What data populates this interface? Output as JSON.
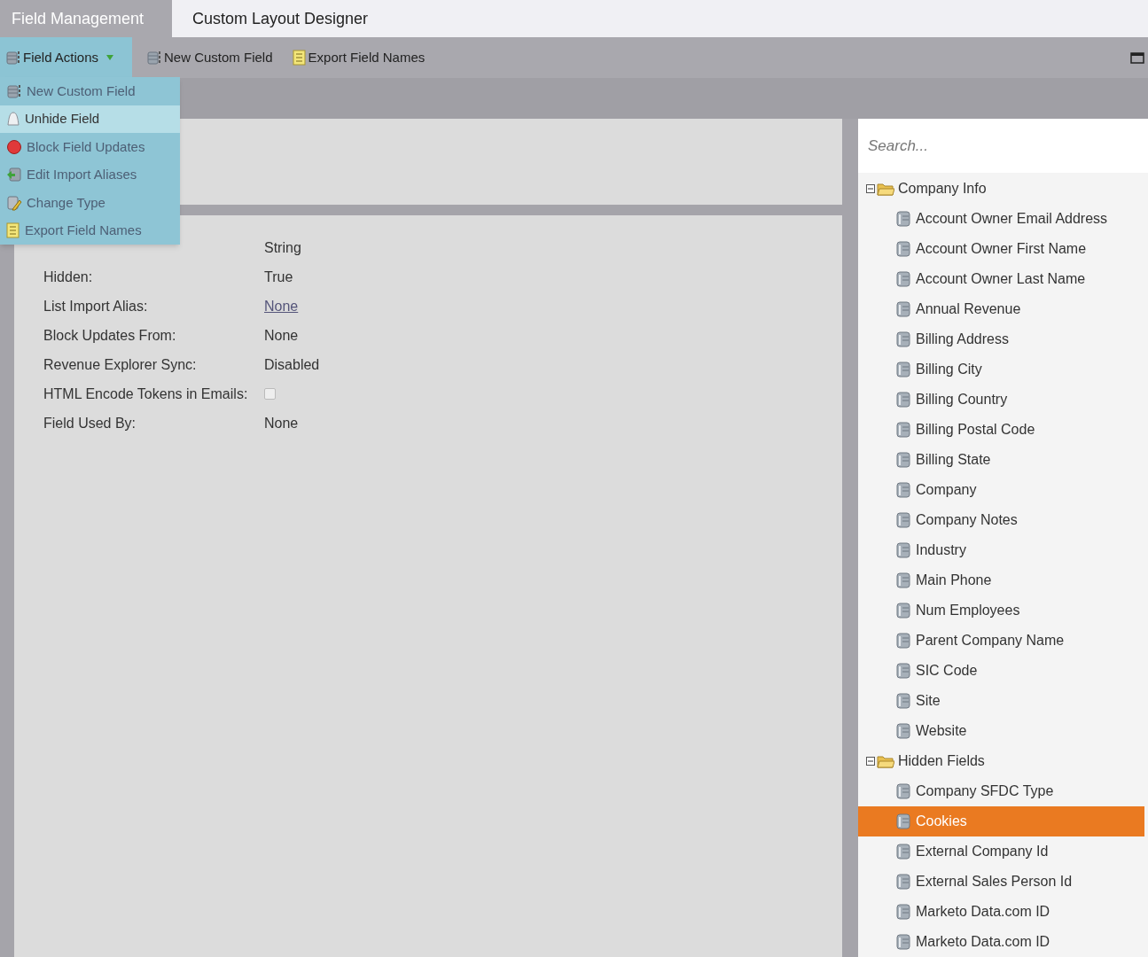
{
  "tabs": [
    {
      "label": "Field Management",
      "selected": true
    },
    {
      "label": "Custom Layout Designer",
      "selected": false
    }
  ],
  "toolbar": [
    {
      "label": "Field Actions",
      "kind": "db",
      "expanded": true
    },
    {
      "label": "New Custom Field",
      "kind": "db"
    },
    {
      "label": "Export Field Names",
      "kind": "sheet"
    }
  ],
  "menu": [
    {
      "label": "New Custom Field",
      "kind": "db",
      "highlighted": false
    },
    {
      "label": "Unhide Field",
      "kind": "ghost",
      "highlighted": true
    },
    {
      "label": "Block Field Updates",
      "kind": "stop",
      "highlighted": false
    },
    {
      "label": "Edit Import Aliases",
      "kind": "alias",
      "highlighted": false
    },
    {
      "label": "Change Type",
      "kind": "edit",
      "highlighted": false
    },
    {
      "label": "Export Field Names",
      "kind": "sheet",
      "highlighted": false
    }
  ],
  "details": [
    {
      "kind": "text",
      "value": "String"
    },
    {
      "kind": "text",
      "label": "Hidden:",
      "value": "True"
    },
    {
      "kind": "link",
      "label": "List Import Alias:",
      "value": "None"
    },
    {
      "kind": "text",
      "label": "Block Updates From:",
      "value": "None"
    },
    {
      "kind": "text",
      "label": "Revenue Explorer Sync:",
      "value": "Disabled"
    },
    {
      "kind": "checkbox",
      "label": "HTML Encode Tokens in Emails:",
      "checked": false
    },
    {
      "kind": "text",
      "label": "Field Used By:",
      "value": "None"
    }
  ],
  "search": {
    "placeholder": "Search..."
  },
  "tree": [
    {
      "label": "Company Info",
      "expanded": true,
      "children": [
        {
          "label": "Account Owner Email Address",
          "selected": false
        },
        {
          "label": "Account Owner First Name",
          "selected": false
        },
        {
          "label": "Account Owner Last Name",
          "selected": false
        },
        {
          "label": "Annual Revenue",
          "selected": false
        },
        {
          "label": "Billing Address",
          "selected": false
        },
        {
          "label": "Billing City",
          "selected": false
        },
        {
          "label": "Billing Country",
          "selected": false
        },
        {
          "label": "Billing Postal Code",
          "selected": false
        },
        {
          "label": "Billing State",
          "selected": false
        },
        {
          "label": "Company",
          "selected": false
        },
        {
          "label": "Company Notes",
          "selected": false
        },
        {
          "label": "Industry",
          "selected": false
        },
        {
          "label": "Main Phone",
          "selected": false
        },
        {
          "label": "Num Employees",
          "selected": false
        },
        {
          "label": "Parent Company Name",
          "selected": false
        },
        {
          "label": "SIC Code",
          "selected": false
        },
        {
          "label": "Site",
          "selected": false
        },
        {
          "label": "Website",
          "selected": false
        }
      ]
    },
    {
      "label": "Hidden Fields",
      "expanded": true,
      "children": [
        {
          "label": "Company SFDC Type",
          "selected": false
        },
        {
          "label": "Cookies",
          "selected": true
        },
        {
          "label": "External Company Id",
          "selected": false
        },
        {
          "label": "External Sales Person Id",
          "selected": false
        },
        {
          "label": "Marketo Data.com ID",
          "selected": false
        },
        {
          "label": "Marketo Data.com ID",
          "selected": false
        }
      ]
    }
  ]
}
